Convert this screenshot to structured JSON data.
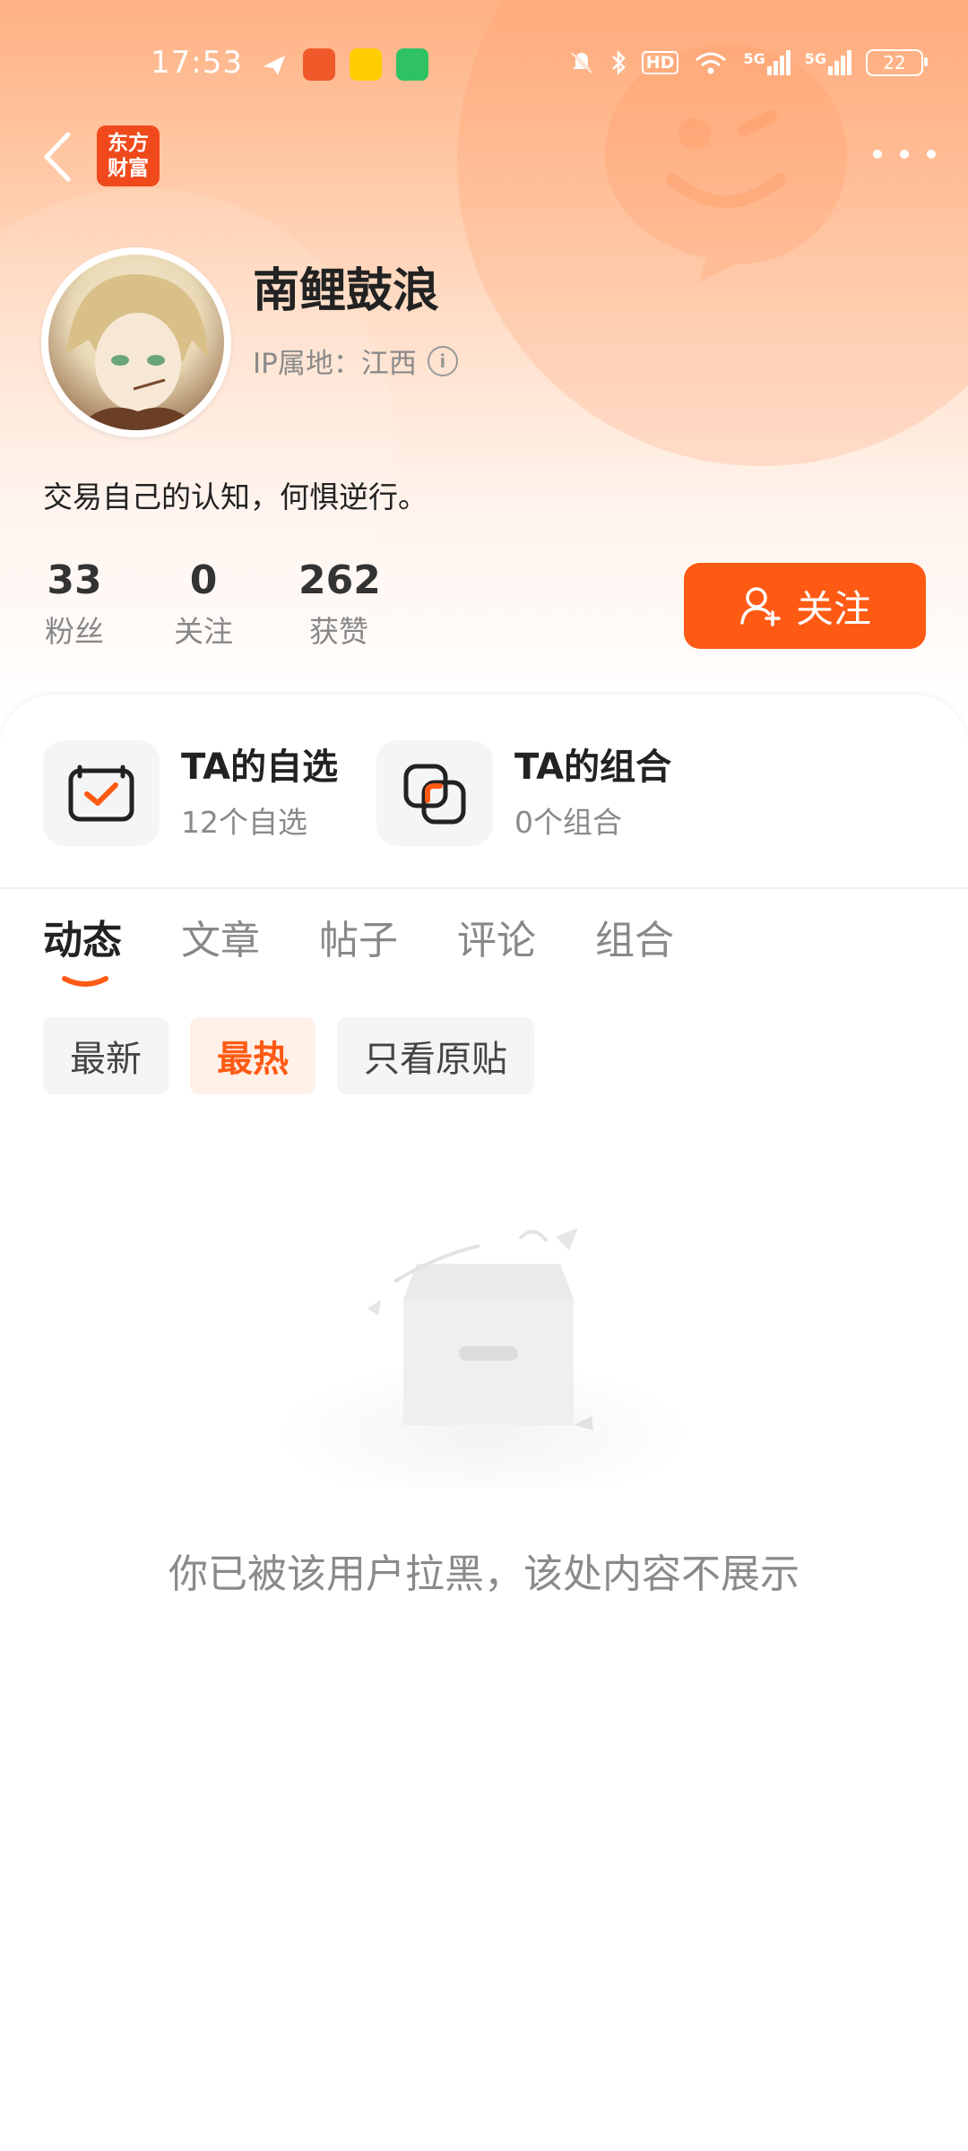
{
  "status_bar": {
    "time": "17:53",
    "hd_label": "HD",
    "network_label_1": "5G",
    "network_label_2": "5G",
    "battery": "22"
  },
  "nav": {
    "logo_line1": "东方",
    "logo_line2": "财富"
  },
  "profile": {
    "username": "南鲤鼓浪",
    "ip_location": "IP属地：江西",
    "bio": "交易自己的认知，何惧逆行。"
  },
  "stats": [
    {
      "value": "33",
      "label": "粉丝"
    },
    {
      "value": "0",
      "label": "关注"
    },
    {
      "value": "262",
      "label": "获赞"
    }
  ],
  "follow_button": {
    "label": "关注"
  },
  "shortcuts": {
    "watchlist": {
      "title": "TA的自选",
      "subtitle": "12个自选"
    },
    "portfolio": {
      "title": "TA的组合",
      "subtitle": "0个组合"
    }
  },
  "tabs": [
    "动态",
    "文章",
    "帖子",
    "评论",
    "组合"
  ],
  "active_tab": "动态",
  "filters": [
    "最新",
    "最热",
    "只看原贴"
  ],
  "active_filter": "最热",
  "empty_message": "你已被该用户拉黑，该处内容不展示",
  "colors": {
    "accent": "#ff5a14",
    "brand_logo": "#f04a1c"
  }
}
